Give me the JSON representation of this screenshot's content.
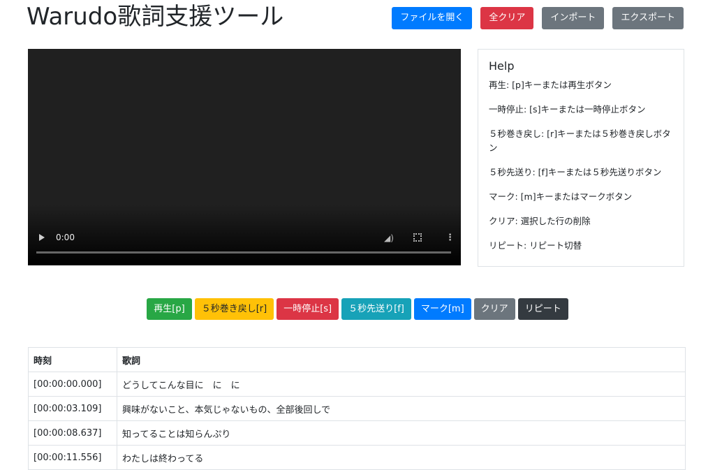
{
  "header": {
    "title": "Warudo歌詞支援ツール",
    "buttons": {
      "open": "ファイルを開く",
      "clear_all": "全クリア",
      "import": "インポート",
      "export": "エクスポート"
    }
  },
  "video": {
    "time": "0:00",
    "icons": [
      "play-icon",
      "volume-icon",
      "fullscreen-icon",
      "more-options-icon"
    ]
  },
  "help": {
    "title": "Help",
    "items": [
      "再生: [p]キーまたは再生ボタン",
      "一時停止: [s]キーまたは一時停止ボタン",
      "５秒巻き戻し: [r]キーまたは５秒巻き戻しボタン",
      "５秒先送り: [f]キーまたは５秒先送りボタン",
      "マーク: [m]キーまたはマークボタン",
      "クリア: 選択した行の削除",
      "リピート: リピート切替"
    ]
  },
  "controls": {
    "play": "再生[p]",
    "rewind": "５秒巻き戻し[r]",
    "pause": "一時停止[s]",
    "forward": "５秒先送り[f]",
    "mark": "マーク[m]",
    "clear": "クリア",
    "repeat": "リピート"
  },
  "table": {
    "headers": [
      "時刻",
      "歌詞"
    ],
    "rows": [
      [
        "[00:00:00.000]",
        "どうしてこんな目に　に　に"
      ],
      [
        "[00:00:03.109]",
        "興味がないこと、本気じゃないもの、全部後回しで"
      ],
      [
        "[00:00:08.637]",
        "知ってることは知らんぷり"
      ],
      [
        "[00:00:11.556]",
        "わたしは終わってる"
      ]
    ]
  },
  "colors": {
    "primary": "#007bff",
    "danger": "#dc3545",
    "secondary": "#6c757d",
    "success": "#28a745",
    "warning": "#ffc107",
    "info": "#17a2b8",
    "dark": "#343a40"
  }
}
